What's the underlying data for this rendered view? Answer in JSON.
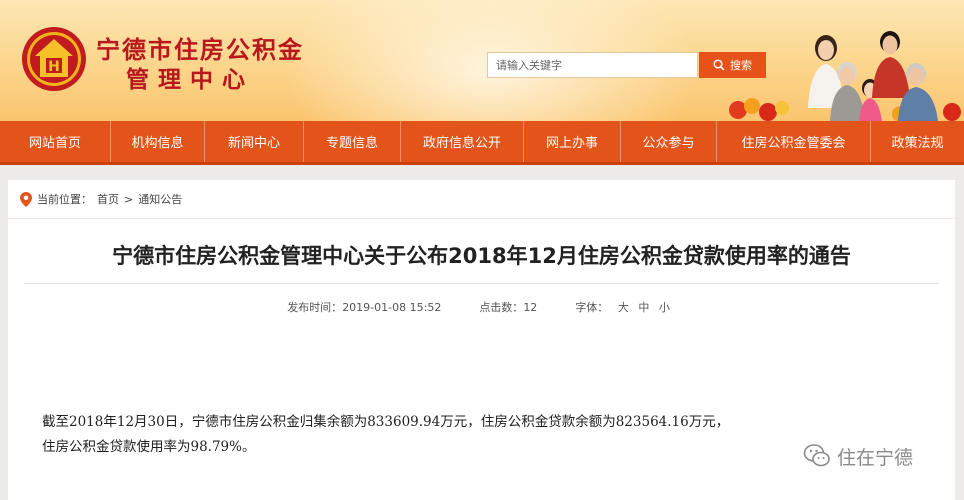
{
  "header": {
    "org_name_line1": "宁德市住房公积金",
    "org_name_line2": "管理中心",
    "search": {
      "placeholder": "请输入关键字",
      "button_label": "搜索"
    },
    "colors": {
      "brand_red": "#b8181c",
      "accent_orange": "#e2541a"
    }
  },
  "nav": {
    "items": [
      {
        "label": "网站首页"
      },
      {
        "label": "机构信息"
      },
      {
        "label": "新闻中心"
      },
      {
        "label": "专题信息"
      },
      {
        "label": "政府信息公开"
      },
      {
        "label": "网上办事"
      },
      {
        "label": "公众参与"
      },
      {
        "label": "住房公积金管委会"
      },
      {
        "label": "政策法规"
      }
    ]
  },
  "breadcrumb": {
    "prefix": "当前位置：",
    "home": "首页",
    "separator": ">",
    "current": "通知公告",
    "icon": "location-pin-icon"
  },
  "article": {
    "title": "宁德市住房公积金管理中心关于公布2018年12月住房公积金贷款使用率的通告",
    "meta": {
      "publish_label": "发布时间：",
      "publish_time": "2019-01-08 15:52",
      "clicks_label": "点击数：",
      "clicks": "12",
      "font_label": "字体：",
      "font_large": "大",
      "font_medium": "中",
      "font_small": "小"
    },
    "paragraph_line1": "截至2018年12月30日，宁德市住房公积金归集余额为833609.94万元，住房公积金贷款余额为823564.16万元，",
    "paragraph_line2": "住房公积金贷款使用率为98.79%。"
  },
  "watermark": {
    "text": "住在宁德",
    "icon": "wechat-icon"
  }
}
